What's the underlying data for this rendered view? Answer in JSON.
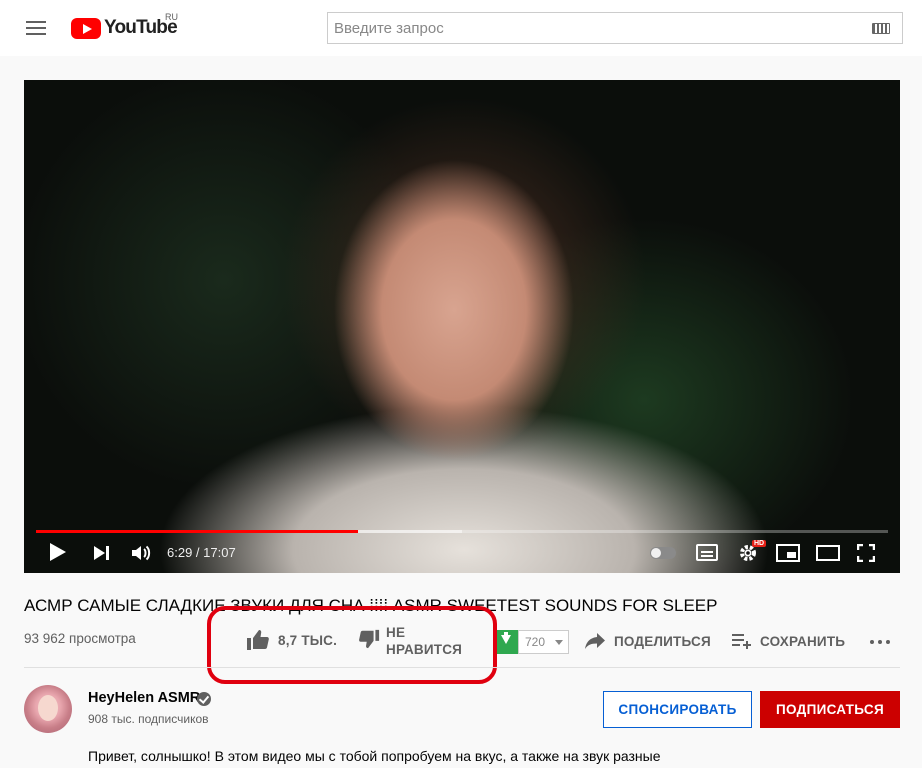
{
  "header": {
    "logo_text": "YouTube",
    "logo_region": "RU",
    "search_placeholder": "Введите запрос"
  },
  "player": {
    "time_display": "6:29 / 17:07",
    "progress_fraction": 0.378,
    "buffer_fraction": 0.5,
    "hd_badge": "HD"
  },
  "video": {
    "title": "АСМР САМЫЕ СЛАДКИЕ ЗВУКИ ДЛЯ СНА ⁞⁞⁞⁞ ASMR SWEETEST SOUNDS FOR SLEEP",
    "views": "93 962 просмотра"
  },
  "actions": {
    "like_count": "8,7 ТЫС.",
    "dislike_line1": "НЕ",
    "dislike_line2": "НРАВИТСЯ",
    "quality": "720",
    "share_label": "ПОДЕЛИТЬСЯ",
    "save_label": "СОХРАНИТЬ"
  },
  "channel": {
    "name": "HeyHelen ASMR",
    "subscribers": "908 тыс. подписчиков",
    "sponsor_label": "СПОНСИРОВАТЬ",
    "subscribe_label": "ПОДПИСАТЬСЯ"
  },
  "description": {
    "first_line": "Привет, солнышко! В этом видео мы с тобой попробуем на вкус, а также на звук разные"
  },
  "colors": {
    "brand_red": "#ff0000",
    "subscribe_red": "#cc0000",
    "sponsor_blue": "#065fd4",
    "annotation_red": "#e0000f",
    "download_green": "#2fa84f"
  }
}
